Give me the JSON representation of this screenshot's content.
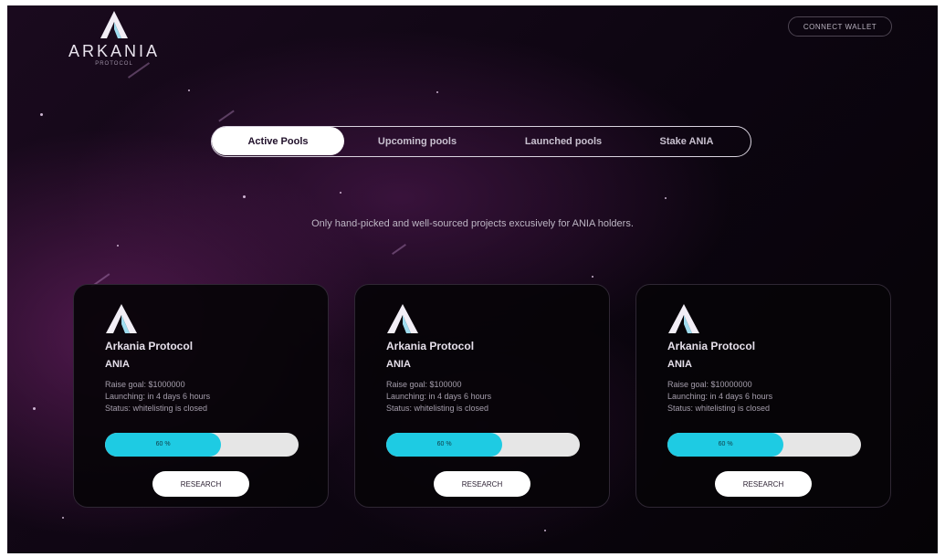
{
  "header": {
    "logo_word": "ARKANIA",
    "logo_sub": "PROTOCOL",
    "connect_wallet_label": "CONNECT WALLET"
  },
  "tabs": [
    {
      "label": "Active Pools",
      "active": true
    },
    {
      "label": "Upcoming pools",
      "active": false
    },
    {
      "label": "Launched pools",
      "active": false
    },
    {
      "label": "Stake ANIA",
      "active": false
    }
  ],
  "tagline": "Only hand-picked and well-sourced projects excusively for ANIA holders.",
  "pools": [
    {
      "name": "Arkania Protocol",
      "ticker": "ANIA",
      "raise_goal": "Raise goal: $1000000",
      "launching": "Launching: in 4 days 6 hours",
      "status": "Status: whitelisting is closed",
      "progress_percent": 60,
      "progress_label": "60 %",
      "button_label": "RESEARCH"
    },
    {
      "name": "Arkania Protocol",
      "ticker": "ANIA",
      "raise_goal": "Raise goal: $100000",
      "launching": "Launching: in 4 days 6 hours",
      "status": "Status: whitelisting is closed",
      "progress_percent": 60,
      "progress_label": "60 %",
      "button_label": "RESEARCH"
    },
    {
      "name": "Arkania Protocol",
      "ticker": "ANIA",
      "raise_goal": "Raise goal: $10000000",
      "launching": "Launching: in 4 days 6 hours",
      "status": "Status: whitelisting is closed",
      "progress_percent": 60,
      "progress_label": "60 %",
      "button_label": "RESEARCH"
    }
  ],
  "colors": {
    "accent_cyan": "#1ecbe3",
    "background_dark": "#0c0510",
    "purple_glow": "#5c1c58"
  }
}
